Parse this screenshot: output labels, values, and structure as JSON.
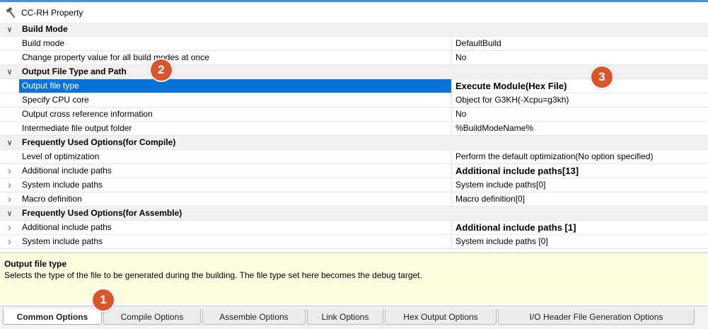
{
  "window": {
    "title": "CC-RH Property",
    "icon": "hammer-icon"
  },
  "rows": [
    {
      "type": "category",
      "name": "Build Mode",
      "value": "",
      "expand": "expanded"
    },
    {
      "type": "prop",
      "name": "Build mode",
      "value": "DefaultBuild"
    },
    {
      "type": "prop",
      "name": "Change property value for all build modes at once",
      "value": "No"
    },
    {
      "type": "category",
      "name": "Output File Type and Path",
      "value": "",
      "expand": "expanded"
    },
    {
      "type": "prop",
      "name": "Output file type",
      "value": "Execute Module(Hex File)",
      "selected": true
    },
    {
      "type": "prop",
      "name": "Specify CPU core",
      "value": "Object for G3KH(-Xcpu=g3kh)"
    },
    {
      "type": "prop",
      "name": "Output cross reference information",
      "value": "No"
    },
    {
      "type": "prop",
      "name": "Intermediate file output folder",
      "value": "%BuildModeName%"
    },
    {
      "type": "category",
      "name": "Frequently Used Options(for Compile)",
      "value": "",
      "expand": "expanded"
    },
    {
      "type": "prop",
      "name": "Level of optimization",
      "value": "Perform the default optimization(No option specified)"
    },
    {
      "type": "prop",
      "name": "Additional include paths",
      "value": "Additional include paths[13]",
      "expand": "collapsed",
      "bold": true
    },
    {
      "type": "prop",
      "name": "System include paths",
      "value": "System include paths[0]",
      "expand": "collapsed"
    },
    {
      "type": "prop",
      "name": "Macro definition",
      "value": "Macro definition[0]",
      "expand": "collapsed"
    },
    {
      "type": "category",
      "name": "Frequently Used Options(for Assemble)",
      "value": "",
      "expand": "expanded"
    },
    {
      "type": "prop",
      "name": "Additional include paths",
      "value": "Additional include paths [1]",
      "expand": "collapsed",
      "bold": true
    },
    {
      "type": "prop",
      "name": "System include paths",
      "value": "System include paths [0]",
      "expand": "collapsed"
    }
  ],
  "description": {
    "title": "Output file type",
    "text": "Selects the type of the file to be generated during the building. The file type set here becomes the debug target."
  },
  "tabs": [
    {
      "label": "Common Options",
      "active": true
    },
    {
      "label": "Compile Options",
      "active": false
    },
    {
      "label": "Assemble Options",
      "active": false
    },
    {
      "label": "Link Options",
      "active": false
    },
    {
      "label": "Hex Output Options",
      "active": false
    },
    {
      "label": "I/O Header File Generation Options",
      "active": false
    }
  ],
  "badges": [
    "1",
    "2",
    "3"
  ],
  "colors": {
    "selection": "#0a74d6",
    "badge": "#d9552b",
    "description_bg": "#fdfde0",
    "category_bg": "#f0f0f0"
  }
}
